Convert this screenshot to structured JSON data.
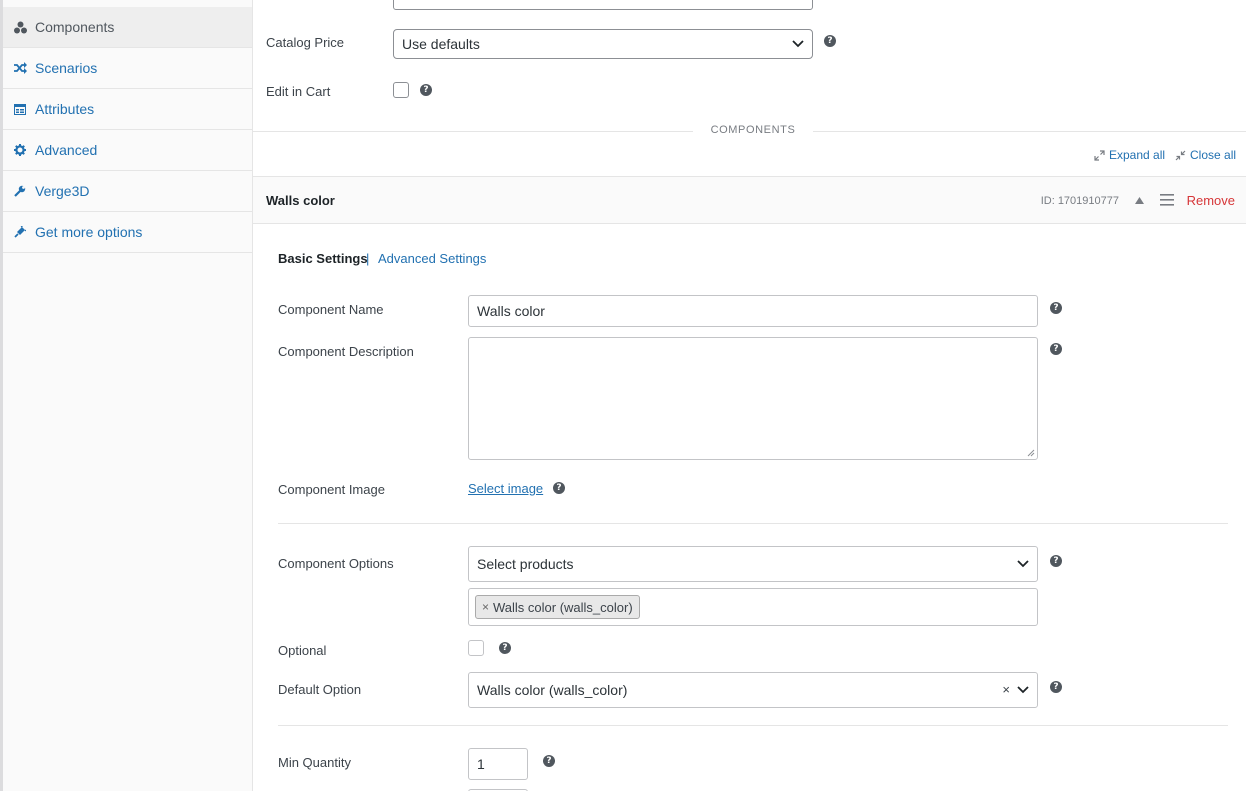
{
  "sidebar": {
    "items": [
      {
        "label": "Components",
        "icon": "components-icon",
        "active": true
      },
      {
        "label": "Scenarios",
        "icon": "shuffle-icon",
        "active": false
      },
      {
        "label": "Attributes",
        "icon": "list-icon",
        "active": false
      },
      {
        "label": "Advanced",
        "icon": "gear-icon",
        "active": false
      },
      {
        "label": "Verge3D",
        "icon": "wrench-icon",
        "active": false
      },
      {
        "label": "Get more options",
        "icon": "plugin-icon",
        "active": false
      }
    ]
  },
  "settings": {
    "catalog_price_label": "Catalog Price",
    "catalog_price_value": "Use defaults",
    "edit_in_cart_label": "Edit in Cart",
    "help_glyph": "?"
  },
  "components_section": {
    "heading": "COMPONENTS",
    "expand_all": "Expand all",
    "close_all": "Close all"
  },
  "component": {
    "title": "Walls color",
    "id_text": "ID: 1701910777",
    "remove_label": "Remove",
    "tabs": {
      "basic": "Basic Settings",
      "separator": "|",
      "advanced": "Advanced Settings"
    },
    "fields": {
      "name_label": "Component Name",
      "name_value": "Walls color",
      "description_label": "Component Description",
      "description_value": "",
      "image_label": "Component Image",
      "image_link": "Select image",
      "options_label": "Component Options",
      "options_placeholder": "Select products",
      "options_selected_tag": "Walls color (walls_color)",
      "tag_remove_glyph": "×",
      "optional_label": "Optional",
      "default_option_label": "Default Option",
      "default_option_value": "Walls color (walls_color)",
      "clear_glyph": "×",
      "min_quantity_label": "Min Quantity",
      "min_quantity_value": "1"
    }
  }
}
